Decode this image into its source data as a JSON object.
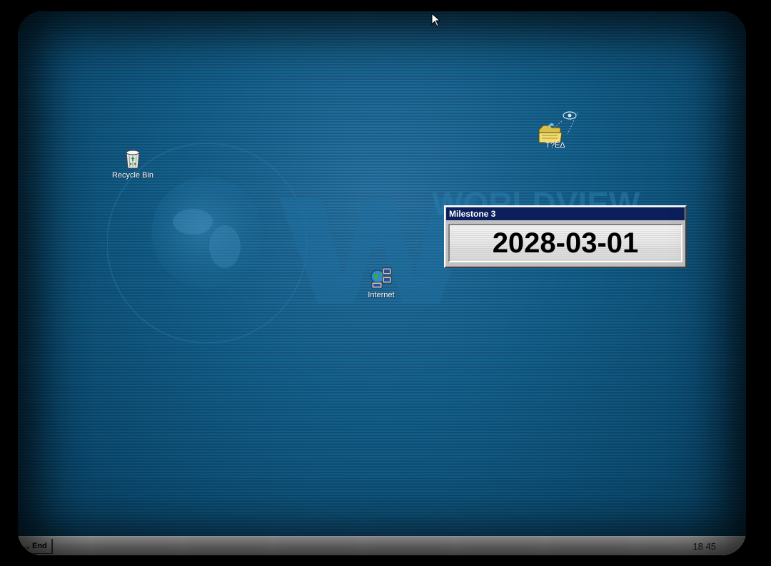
{
  "wallpaper": {
    "brand_text": "WORLDVIEW"
  },
  "desktop": {
    "icons": [
      {
        "label": "Recycle Bin",
        "icon": "recycle-bin-icon"
      },
      {
        "label": "T?ÊΔ",
        "icon": "folder-eye-icon"
      },
      {
        "label": "Internet",
        "icon": "internet-globe-computers-icon"
      }
    ]
  },
  "milestone_window": {
    "title": "Milestone 3",
    "value": "2028-03-01"
  },
  "taskbar": {
    "start_label": "End",
    "clock": "18 45"
  },
  "colors": {
    "desktop_blue": "#14628f",
    "titlebar_navy": "#0a1f5c",
    "window_gray": "#c0c0c0"
  }
}
